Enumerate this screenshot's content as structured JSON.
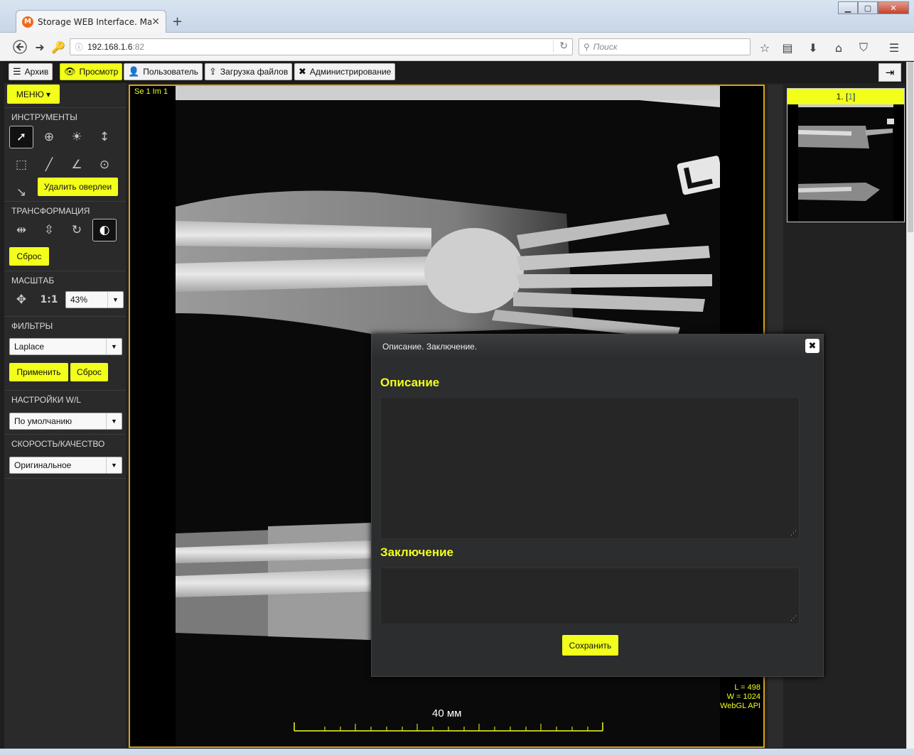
{
  "browser": {
    "tab_title": "Storage WEB Interface. Ma...",
    "new_tab": "+",
    "url_host": "192.168.1.6",
    "url_port": ":82",
    "search_placeholder": "Поиск"
  },
  "topnav": {
    "items": [
      {
        "label": "Архив",
        "icon": "list-icon"
      },
      {
        "label": "Просмотр",
        "icon": "eye-icon",
        "active": true
      },
      {
        "label": "Пользователь",
        "icon": "user-icon"
      },
      {
        "label": "Загрузка файлов",
        "icon": "upload-icon"
      },
      {
        "label": "Администрирование",
        "icon": "tools-icon"
      }
    ]
  },
  "sidebar": {
    "menu_label": "МЕНЮ",
    "tools_title": "ИНСТРУМЕНТЫ",
    "delete_overlay": "Удалить оверлеи",
    "transform_title": "ТРАНСФОРМАЦИЯ",
    "transform_reset": "Сброс",
    "scale_title": "МАСШТАБ",
    "scale_value": "43%",
    "filters_title": "ФИЛЬТРЫ",
    "filter_value": "Laplace",
    "apply_label": "Применить",
    "filter_reset": "Сброс",
    "wl_title": "НАСТРОЙКИ W/L",
    "wl_value": "По умолчанию",
    "quality_title": "СКОРОСТЬ/КАЧЕСТВО",
    "quality_value": "Оригинальное"
  },
  "viewer": {
    "series_label": "Se 1 Im 1",
    "level": "L = 498",
    "width": "W = 1024",
    "api": "WebGL API",
    "scale_label": "40 мм"
  },
  "thumbnail": {
    "num": "1. [",
    "idx": "1",
    "close": "]"
  },
  "dialog": {
    "title": "Описание. Заключение.",
    "description_label": "Описание",
    "conclusion_label": "Заключение",
    "save_label": "Сохранить"
  },
  "colors": {
    "accent": "#f2ff1a",
    "viewer_border": "#d8a21a"
  }
}
